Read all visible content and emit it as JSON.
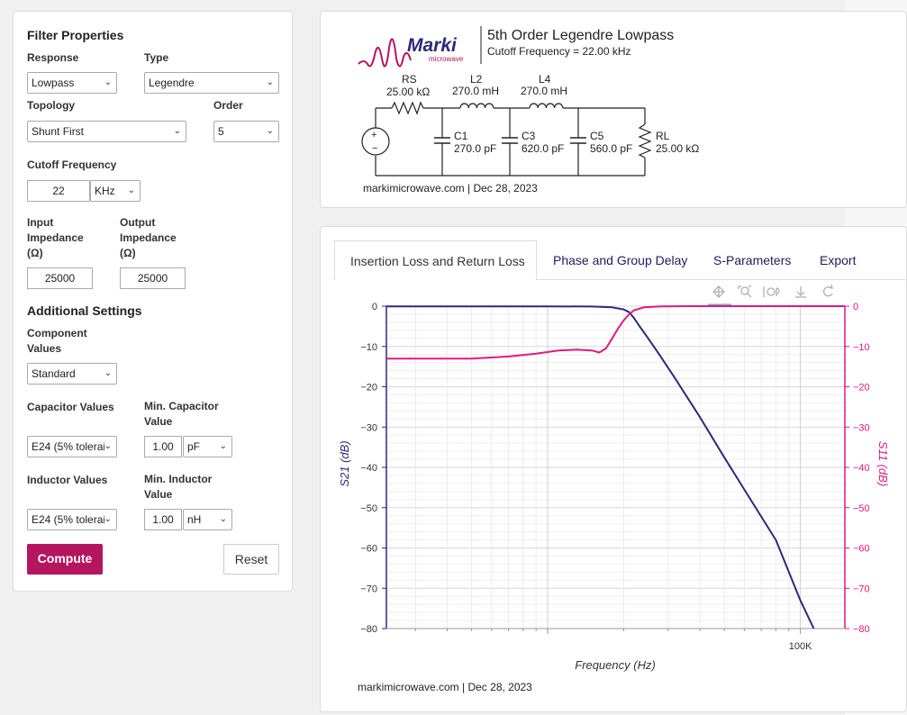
{
  "filter_panel": {
    "title": "Filter Properties",
    "response_label": "Response",
    "response_value": "Lowpass",
    "type_label": "Type",
    "type_value": "Legendre",
    "topology_label": "Topology",
    "topology_value": "Shunt First",
    "order_label": "Order",
    "order_value": "5",
    "cutoff_label": "Cutoff Frequency",
    "cutoff_value": "22",
    "cutoff_unit": "KHz",
    "input_impedance_label_1": "Input",
    "input_impedance_label_2": "Impedance",
    "input_impedance_label_3": "(Ω)",
    "input_impedance_value": "25000",
    "output_impedance_label_1": "Output",
    "output_impedance_label_2": "Impedance",
    "output_impedance_label_3": "(Ω)",
    "output_impedance_value": "25000",
    "additional_title": "Additional Settings",
    "component_values_label_1": "Component",
    "component_values_label_2": "Values",
    "component_values_value": "Standard",
    "capacitor_values_label": "Capacitor Values",
    "capacitor_values_value": "E24 (5% tolerai",
    "min_cap_label_1": "Min. Capacitor",
    "min_cap_label_2": "Value",
    "min_cap_value": "1.00",
    "min_cap_unit": "pF",
    "inductor_values_label": "Inductor Values",
    "inductor_values_value": "E24 (5% tolerai",
    "min_ind_label_1": "Min. Inductor",
    "min_ind_label_2": "Value",
    "min_ind_value": "1.00",
    "min_ind_unit": "nH",
    "compute_label": "Compute",
    "reset_label": "Reset"
  },
  "schematic": {
    "logo_text": "Marki",
    "logo_sub": "microwave",
    "title": "5th Order Legendre Lowpass",
    "subtitle": "Cutoff Frequency = 22.00 kHz",
    "rs_name": "RS",
    "rs_value": "25.00 kΩ",
    "l2_name": "L2",
    "l2_value": "270.0 mH",
    "l4_name": "L4",
    "l4_value": "270.0 mH",
    "c1_name": "C1",
    "c1_value": "270.0 pF",
    "c3_name": "C3",
    "c3_value": "620.0 pF",
    "c5_name": "C5",
    "c5_value": "560.0 pF",
    "rl_name": "RL",
    "rl_value": "25.00 kΩ",
    "footer": "markimicrowave.com | Dec 28, 2023",
    "accent": "#b5145e"
  },
  "tabs": [
    {
      "label": "Insertion Loss and Return Loss"
    },
    {
      "label": "Phase and Group Delay"
    },
    {
      "label": "S-Parameters"
    },
    {
      "label": "Export"
    }
  ],
  "toolbar_icons": [
    "move-icon",
    "zoom-icon",
    "autoscale-icon",
    "download-icon",
    "reset-icon"
  ],
  "chart_footer": "markimicrowave.com | Dec 28, 2023",
  "chart_data": {
    "type": "line",
    "xlabel": "Frequency (Hz)",
    "ylabel_left": "S21 (dB)",
    "ylabel_right": "S11 (dB)",
    "x_scale": "log",
    "x_tick_labels": [
      {
        "x": 100000,
        "label": "100K"
      }
    ],
    "ylim": [
      -80,
      0
    ],
    "y_ticks": [
      0,
      -10,
      -20,
      -30,
      -40,
      -50,
      -60,
      -70,
      -80
    ],
    "grid": true,
    "colors": {
      "s21": "#2c2a7a",
      "s11": "#e0197f"
    },
    "series": [
      {
        "key": "s21",
        "x": [
          2300,
          5000,
          10000,
          15000,
          18000,
          20000,
          21000,
          22000,
          23000,
          25000,
          28000,
          32000,
          40000,
          50000,
          60000,
          80000,
          100000,
          113000
        ],
        "y": [
          -0.05,
          -0.05,
          -0.05,
          -0.08,
          -0.3,
          -0.8,
          -1.5,
          -3.0,
          -4.8,
          -8.0,
          -12.5,
          -18.0,
          -27.5,
          -37.5,
          -45.5,
          -58.0,
          -73.0,
          -80.0
        ]
      },
      {
        "key": "s11",
        "x": [
          2300,
          5000,
          7000,
          9000,
          11000,
          13000,
          15000,
          16000,
          17000,
          18000,
          19000,
          20000,
          21000,
          22000,
          24000,
          28000,
          35000,
          50000,
          150000
        ],
        "y": [
          -13.0,
          -13.0,
          -12.5,
          -11.8,
          -11.0,
          -10.8,
          -11.0,
          -11.5,
          -10.5,
          -8.0,
          -5.5,
          -3.5,
          -2.0,
          -1.0,
          -0.3,
          -0.05,
          0,
          0,
          0
        ]
      }
    ]
  }
}
